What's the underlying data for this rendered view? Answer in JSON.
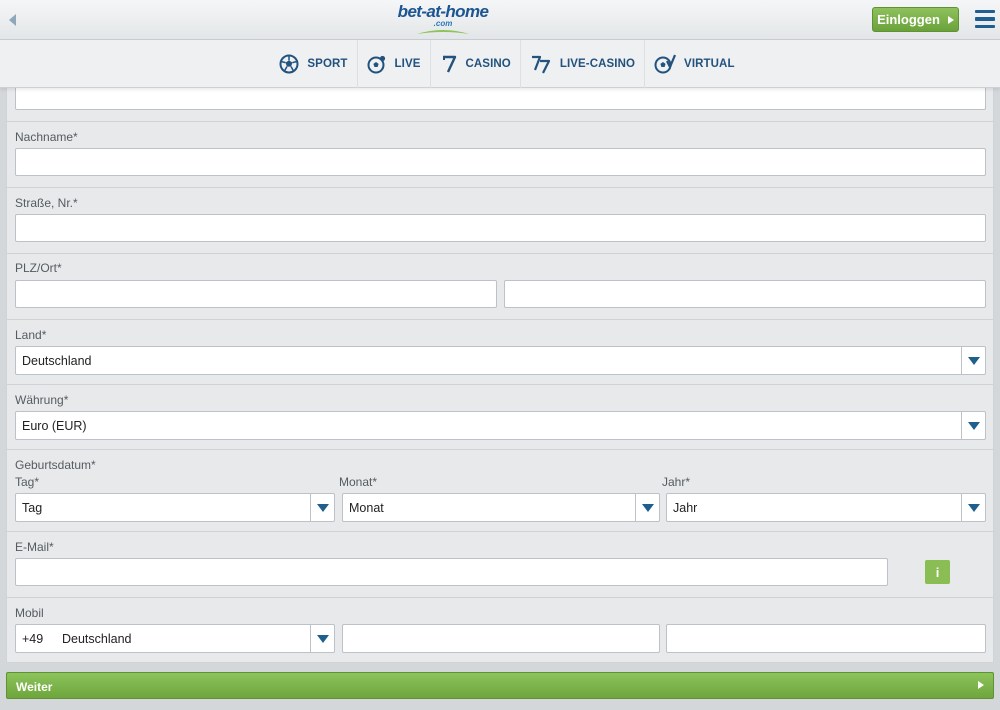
{
  "header": {
    "logo_main": "bet-at-home",
    "logo_sub": ".com",
    "login_label": "Einloggen"
  },
  "nav": [
    {
      "label": "SPORT",
      "icon": "soccer-ball-icon"
    },
    {
      "label": "LIVE",
      "icon": "live-ball-icon"
    },
    {
      "label": "CASINO",
      "icon": "seven-icon"
    },
    {
      "label": "LIVE-CASINO",
      "icon": "seventy-seven-icon"
    },
    {
      "label": "VIRTUAL",
      "icon": "virtual-ball-icon"
    }
  ],
  "form": {
    "nachname": {
      "label": "Nachname*",
      "value": ""
    },
    "strasse": {
      "label": "Straße, Nr.*",
      "value": ""
    },
    "plz_ort": {
      "label": "PLZ/Ort*",
      "plz": "",
      "ort": ""
    },
    "land": {
      "label": "Land*",
      "value": "Deutschland"
    },
    "waehrung": {
      "label": "Währung*",
      "value": "Euro (EUR)"
    },
    "geburtsdatum": {
      "label": "Geburtsdatum*",
      "tag": {
        "label": "Tag*",
        "value": "Tag"
      },
      "monat": {
        "label": "Monat*",
        "value": "Monat"
      },
      "jahr": {
        "label": "Jahr*",
        "value": "Jahr"
      }
    },
    "email": {
      "label": "E-Mail*",
      "value": "",
      "info": "i"
    },
    "mobil": {
      "label": "Mobil",
      "code": "+49",
      "country": "Deutschland",
      "prefix": "",
      "number": ""
    }
  },
  "next_label": "Weiter",
  "colors": {
    "accent_green": "#7ab048",
    "brand_blue": "#1f5e92"
  }
}
